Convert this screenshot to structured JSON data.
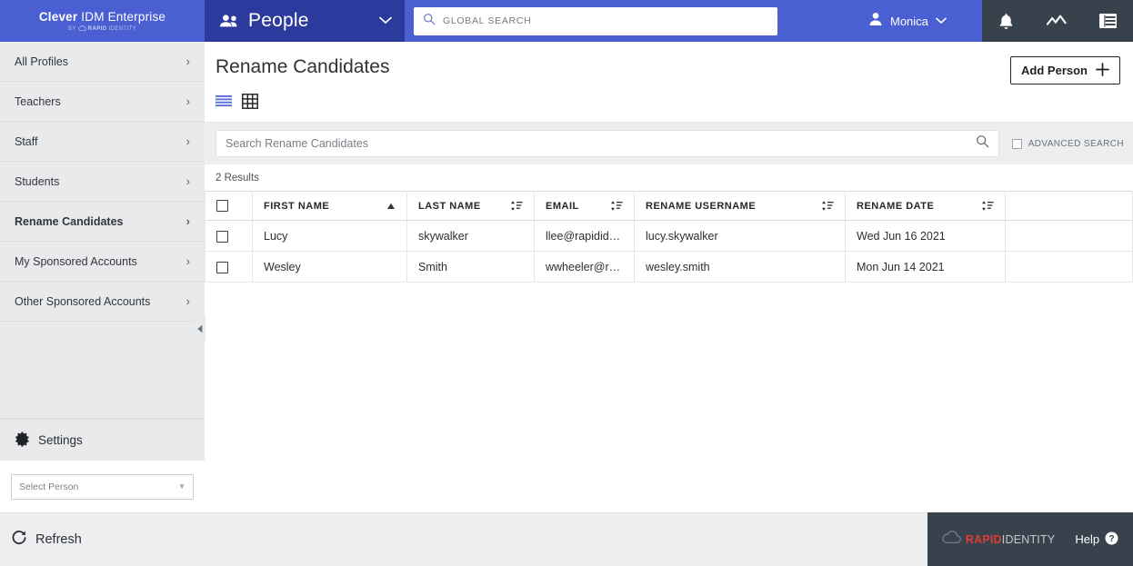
{
  "topbar": {
    "brand_name_bold": "Clever",
    "brand_name_rest": " IDM Enterprise",
    "brand_by": "BY",
    "brand_rapid": "RAPID",
    "brand_identity": "IDENTITY",
    "section_title": "People",
    "section_icon": "people-icon",
    "section_chevron_icon": "chevron-down-icon",
    "global_search_placeholder": "GLOBAL SEARCH",
    "global_search_value": "",
    "global_search_icon": "search-icon",
    "user_name": "Monica",
    "user_icon": "person-icon",
    "user_chevron_icon": "chevron-down-icon",
    "notifications_icon": "bell-icon",
    "analytics_icon": "trend-line-icon",
    "menu_icon": "list-menu-icon"
  },
  "sidebar": {
    "items": [
      {
        "label": "All Profiles",
        "active": false,
        "chevron": "chevron-right-icon"
      },
      {
        "label": "Teachers",
        "active": false,
        "chevron": "chevron-right-icon"
      },
      {
        "label": "Staff",
        "active": false,
        "chevron": "chevron-right-icon"
      },
      {
        "label": "Students",
        "active": false,
        "chevron": "chevron-right-icon"
      },
      {
        "label": "Rename Candidates",
        "active": true,
        "chevron": "chevron-right-icon"
      },
      {
        "label": "My Sponsored Accounts",
        "active": false,
        "chevron": "chevron-right-icon"
      },
      {
        "label": "Other Sponsored Accounts",
        "active": false,
        "chevron": "chevron-right-icon"
      }
    ],
    "settings_label": "Settings",
    "settings_icon": "gear-icon",
    "select_person_placeholder": "Select Person",
    "collapse_icon": "collapse-left-arrow-icon"
  },
  "main": {
    "page_title": "Rename Candidates",
    "add_person_label": "Add Person",
    "add_person_icon": "plus-icon",
    "view_list_icon": "list-view-icon",
    "view_grid_icon": "grid-view-icon",
    "view_active": "list",
    "search_placeholder": "Search Rename Candidates",
    "search_value": "",
    "search_icon": "search-icon",
    "advanced_search_label": "ADVANCED SEARCH",
    "advanced_search_checked": false,
    "results_count": "2 Results"
  },
  "table": {
    "select_all_checked": false,
    "columns": [
      {
        "label": "FIRST NAME",
        "sort": "asc",
        "sort_icon": "sort-ascending-arrow-icon"
      },
      {
        "label": "LAST NAME",
        "sort": "none",
        "sort_icon": "sort-icon"
      },
      {
        "label": "EMAIL",
        "sort": "none",
        "sort_icon": "sort-icon"
      },
      {
        "label": "RENAME USERNAME",
        "sort": "none",
        "sort_icon": "sort-icon"
      },
      {
        "label": "RENAME DATE",
        "sort": "none",
        "sort_icon": "sort-icon"
      }
    ],
    "rows": [
      {
        "checked": false,
        "first_name": "Lucy",
        "last_name": "skywalker",
        "email": "llee@rapidide...",
        "rename_username": "lucy.skywalker",
        "rename_date": "Wed Jun 16 2021"
      },
      {
        "checked": false,
        "first_name": "Wesley",
        "last_name": "Smith",
        "email": "wwheeler@ra...",
        "rename_username": "wesley.smith",
        "rename_date": "Mon Jun 14 2021"
      }
    ]
  },
  "footer": {
    "refresh_label": "Refresh",
    "refresh_icon": "refresh-icon",
    "logo_cloud_icon": "cloud-icon",
    "logo_rapid": "RAPID",
    "logo_identity": "IDENTITY",
    "help_label": "Help",
    "help_icon": "question-mark-circle-icon"
  },
  "colors": {
    "brand_blue": "#4a5fd2",
    "section_blue": "#2b3a9c",
    "dark_slate": "#38424d",
    "sidebar_gray": "#e8eaec",
    "band_gray": "#eceef0",
    "accent_red": "#e03a35",
    "list_icon_blue": "#5a6fd8"
  }
}
